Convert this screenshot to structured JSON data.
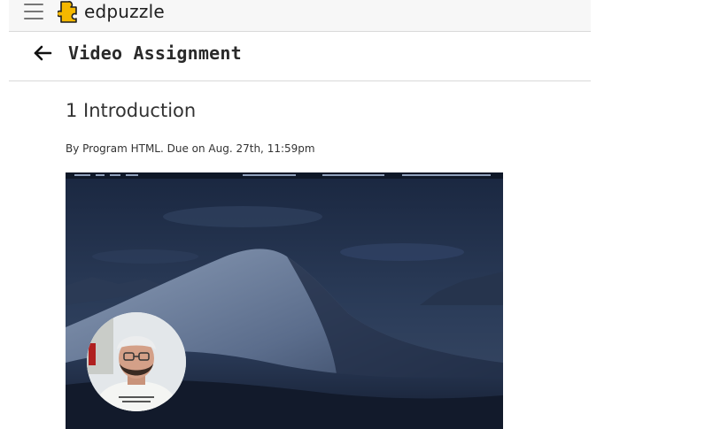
{
  "header": {
    "logo_text": "edpuzzle",
    "menu_icon": "hamburger-menu-icon",
    "logo_icon": "edpuzzle-puzzle-logo-icon",
    "brand_color": "#f5b800"
  },
  "titlebar": {
    "back_icon": "arrow-left-icon",
    "title": "Video Assignment"
  },
  "assignment": {
    "lesson_title": "1 Introduction",
    "meta": "By Program HTML. Due on Aug. 27th, 11:59pm"
  },
  "video": {
    "description_icon": "video-thumbnail",
    "webcam_icon": "presenter-webcam-icon"
  }
}
